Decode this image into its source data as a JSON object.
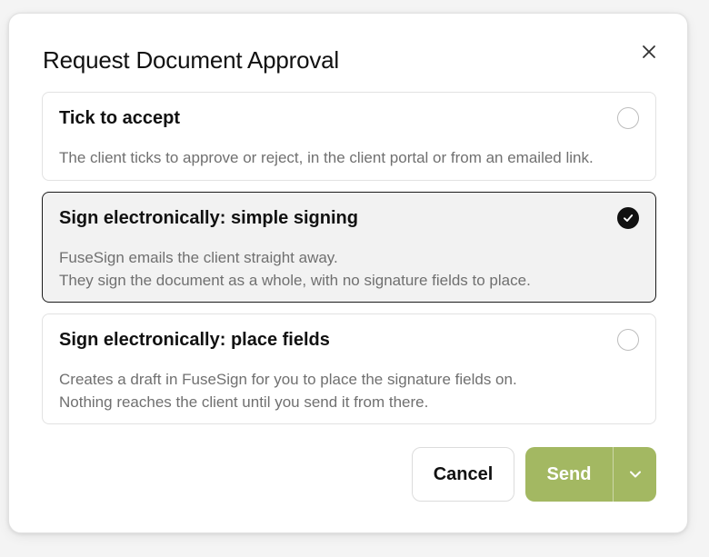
{
  "dialog": {
    "title": "Request Document Approval",
    "close_icon": "close-icon"
  },
  "options": [
    {
      "title": "Tick to accept",
      "lines": [
        "The client ticks to approve or reject, in the client portal or from an emailed link."
      ],
      "selected": false
    },
    {
      "title": "Sign electronically: simple signing",
      "lines": [
        "FuseSign emails the client straight away.",
        "They sign the document as a whole, with no signature fields to place."
      ],
      "selected": true
    },
    {
      "title": "Sign electronically: place fields",
      "lines": [
        "Creates a draft in FuseSign for you to place the signature fields on.",
        "Nothing reaches the client until you send it from there."
      ],
      "selected": false
    }
  ],
  "footer": {
    "cancel_label": "Cancel",
    "send_label": "Send",
    "send_menu_icon": "chevron-down-icon"
  },
  "colors": {
    "send_button": "#a3b862",
    "selected_border": "#1a1a1a",
    "selected_background": "#f2f2f2"
  }
}
